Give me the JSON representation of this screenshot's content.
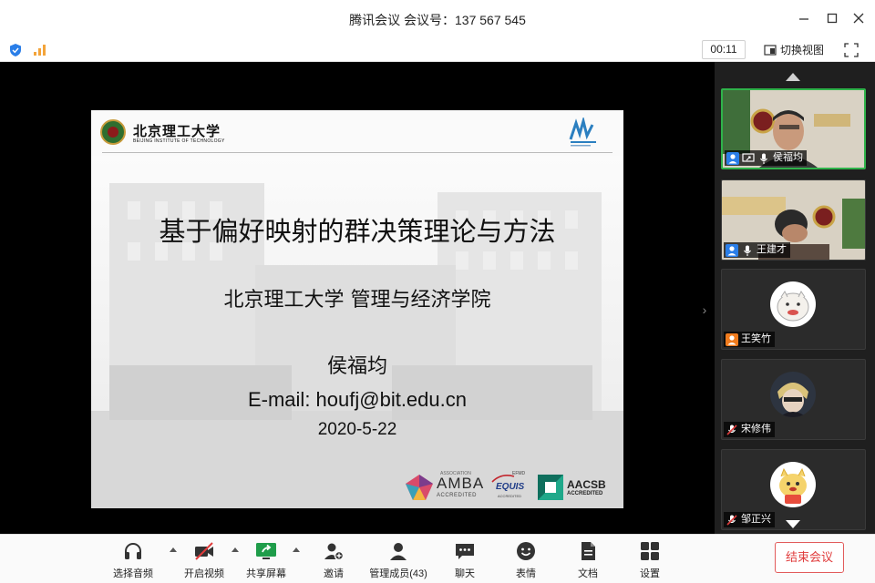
{
  "window": {
    "title": "腾讯会议 会议号：137 567 545",
    "minimize_icon": "minimize-icon",
    "maximize_icon": "maximize-icon",
    "close_icon": "close-icon"
  },
  "status": {
    "timer": "00:11",
    "switch_view_label": "切换视图",
    "security_icon": "shield-icon",
    "network_icon": "signal-icon",
    "fullscreen_icon": "fullscreen-icon"
  },
  "slide": {
    "logo_cn": "北京理工大学",
    "logo_en": "BEIJING INSTITUTE OF TECHNOLOGY",
    "title": "基于偏好映射的群决策理论与方法",
    "subtitle": "北京理工大学 管理与经济学院",
    "author": "侯福均",
    "email": "E-mail: houfj@bit.edu.cn",
    "date": "2020-5-22",
    "accreditations": {
      "amba_top": "ASSOCIATION",
      "amba": "AMBA",
      "amba_sub": "ACCREDITED",
      "equis_top": "EFMD",
      "equis": "EQUIS",
      "equis_sub": "ACCREDITED",
      "aacsb": "AACSB",
      "aacsb_sub": "ACCREDITED"
    }
  },
  "participants": [
    {
      "name": "侯福均",
      "type": "video",
      "active": true,
      "icons": [
        "user-icon",
        "screen-share-icon",
        "mic-icon"
      ]
    },
    {
      "name": "王建才",
      "type": "video",
      "active": false,
      "icons": [
        "user-icon",
        "mic-icon"
      ]
    },
    {
      "name": "王笑竹",
      "type": "avatar",
      "active": false,
      "icons": [
        "user-icon"
      ]
    },
    {
      "name": "宋修伟",
      "type": "avatar",
      "active": false,
      "icons": [
        "mic-muted-icon"
      ]
    },
    {
      "name": "邹正兴",
      "type": "avatar",
      "active": false,
      "icons": [
        "mic-muted-icon"
      ]
    }
  ],
  "toolbar": {
    "audio": "选择音频",
    "video": "开启视频",
    "share": "共享屏幕",
    "invite": "邀请",
    "members": "管理成员(43)",
    "chat": "聊天",
    "emoji": "表情",
    "docs": "文档",
    "settings": "设置",
    "end": "结束会议"
  },
  "colors": {
    "accent_green": "#2fb34a",
    "end_red": "#e03c3c",
    "panel_bg": "#1f1f1f"
  }
}
